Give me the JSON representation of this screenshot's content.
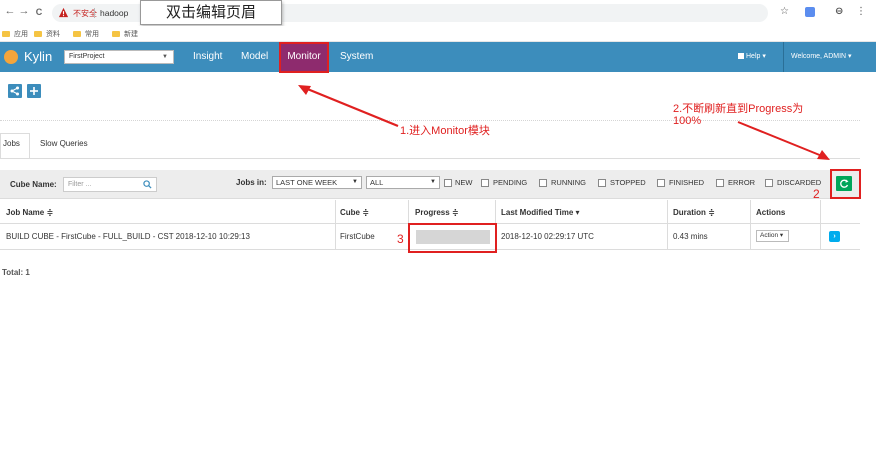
{
  "browser": {
    "back": "←",
    "forward": "→",
    "reload": "C",
    "insecure_label": "不安全",
    "url": "hadoop",
    "header_tooltip": "双击编辑页眉",
    "star": "☆",
    "account": "⊖",
    "menu": "⋮",
    "bookmarks": [
      "应用",
      "资料",
      "常用",
      "新建"
    ]
  },
  "kylin": {
    "brand": "Kylin",
    "project": "FirstProject",
    "nav": [
      "Insight",
      "Model",
      "Monitor",
      "System"
    ],
    "active_nav": "Monitor",
    "help": "Help ▾",
    "welcome": "Welcome, ADMIN ▾",
    "colors": {
      "nav_bg": "#3c8dbc",
      "active_bg": "#8e2b6e",
      "refresh": "#00a65a",
      "annotation": "#e02020"
    }
  },
  "actions": {
    "share_icon": "share-icon",
    "add_icon": "plus-icon"
  },
  "tabs": [
    "Jobs",
    "Slow Queries"
  ],
  "filters": {
    "cube_name_label": "Cube Name:",
    "cube_name_placeholder": "Filter ...",
    "jobs_in_label": "Jobs in:",
    "time_range": "LAST ONE WEEK",
    "status_scope": "ALL",
    "statuses": [
      "NEW",
      "PENDING",
      "RUNNING",
      "STOPPED",
      "FINISHED",
      "ERROR",
      "DISCARDED"
    ]
  },
  "table": {
    "headers": [
      "Job Name ≑",
      "Cube ≑",
      "Progress ≑",
      "Last Modified Time ▾",
      "Duration ≑",
      "Actions"
    ],
    "rows": [
      {
        "job_name": "BUILD CUBE - FirstCube - FULL_BUILD - CST 2018-12-10 10:29:13",
        "cube": "FirstCube",
        "progress_fraction": 1.0,
        "last_modified": "2018-12-10 02:29:17 UTC",
        "duration": "0.43 mins",
        "action": "Action ▾",
        "info": "›"
      }
    ],
    "total": "Total: 1"
  },
  "annotations": {
    "step1": "1.进入Monitor模块",
    "step2_title": "2.不断刷新直到Progress为",
    "step2_value": "100%",
    "label2": "2",
    "label3": "3"
  }
}
